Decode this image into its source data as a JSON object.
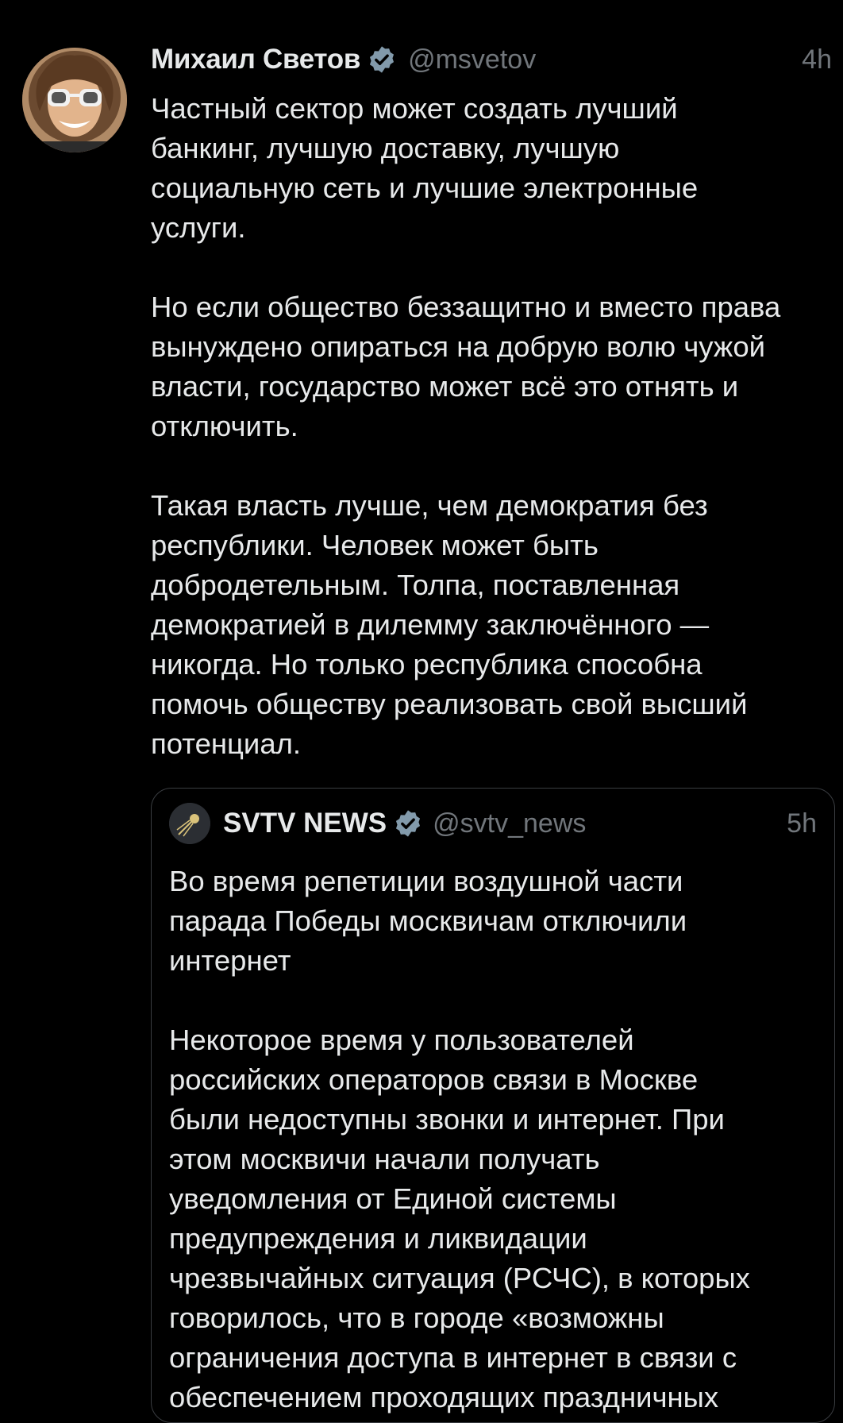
{
  "tweet": {
    "author_name": "Михаил Светов",
    "author_handle": "@msvetov",
    "time": "4h",
    "text": "Частный сектор может создать лучший\nбанкинг, лучшую доставку, лучшую\nсоциальную сеть и лучшие электронные\nуслуги.\n\nНо если общество беззащитно и вместо права\nвынуждено опираться на добрую волю чужой\nвласти, государство может всё это отнять и\nотключить.\n\nТакая власть лучше, чем демократия без\nреспублики. Человек может быть\nдобродетельным. Толпа, поставленная\nдемократией в дилемму заключённого —\nникогда. Но только республика способна\nпомочь обществу реализовать свой высший\nпотенциал."
  },
  "quoted": {
    "author_name": "SVTV NEWS",
    "author_handle": "@svtv_news",
    "time": "5h",
    "text": "Во время репетиции воздушной части\nпарада Победы москвичам отключили\nинтернет\n\nНекоторое время у пользователей\nроссийских операторов связи в Москве\nбыли недоступны звонки и интернет. При\nэтом москвичи начали получать\nуведомления от Единой системы\nпредупреждения и ликвидации\nчрезвычайных ситуация (РСЧС), в которых\nговорилось, что в городе «возможны\nограничения доступа в интернет в связи с\nобеспечением проходящих праздничных"
  },
  "icons": {
    "verified": "verified-badge-icon",
    "satellite": "satellite-icon"
  },
  "colors": {
    "background": "#000000",
    "text": "#e7e9ea",
    "muted": "#71767b",
    "verified": "#829aab"
  }
}
